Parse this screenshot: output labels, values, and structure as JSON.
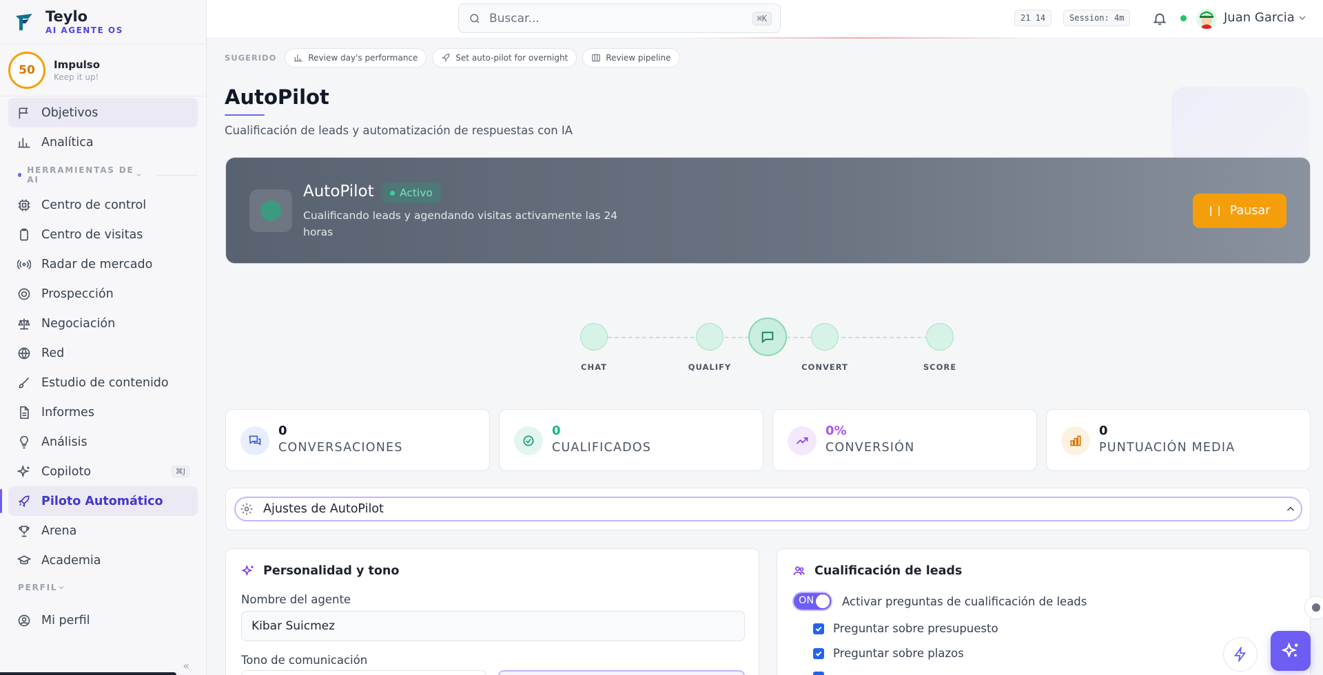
{
  "brand": {
    "name": "Teylo",
    "subtitle": "AI AGENTE OS"
  },
  "streak": {
    "value": "50",
    "title": "Impulso",
    "subtitle": "Keep it up!"
  },
  "nav": {
    "top_items": [
      {
        "label": "Objetivos",
        "icon": "flag-icon"
      },
      {
        "label": "Analítica",
        "icon": "bar-chart-icon"
      }
    ],
    "tools_section": "HERRAMIENTAS DE AI",
    "tools": [
      {
        "label": "Centro de control",
        "icon": "cpu-icon"
      },
      {
        "label": "Centro de visitas",
        "icon": "clipboard-icon"
      },
      {
        "label": "Radar de mercado",
        "icon": "radar-icon"
      },
      {
        "label": "Prospección",
        "icon": "target-icon"
      },
      {
        "label": "Negociación",
        "icon": "scale-icon"
      },
      {
        "label": "Red",
        "icon": "globe-icon"
      },
      {
        "label": "Estudio de contenido",
        "icon": "brush-icon"
      },
      {
        "label": "Informes",
        "icon": "file-icon"
      },
      {
        "label": "Análisis",
        "icon": "bulb-icon"
      },
      {
        "label": "Copiloto",
        "icon": "sparkle-icon",
        "shortcut": "⌘J"
      },
      {
        "label": "Piloto Automático",
        "icon": "rocket-icon"
      },
      {
        "label": "Arena",
        "icon": "trophy-icon"
      },
      {
        "label": "Academia",
        "icon": "graduation-icon"
      }
    ],
    "profile_section": "PERFIL",
    "profile_items": [
      {
        "label": "Mi perfil",
        "icon": "user-circle-icon"
      }
    ],
    "collapse_glyph": "«"
  },
  "topbar": {
    "search_placeholder": "Buscar...",
    "search_shortcut": "⌘K",
    "clock": "21 14",
    "session": "Session: 4m",
    "user_name": "Juan Garcia"
  },
  "suggested": {
    "label": "SUGERIDO",
    "chips": [
      "Review day's performance",
      "Set auto-pilot for overnight",
      "Review pipeline"
    ]
  },
  "page": {
    "title": "AutoPilot",
    "subtitle": "Cualificación de leads y automatización de respuestas con IA"
  },
  "hero": {
    "title": "AutoPilot",
    "status": "Activo",
    "description": "Cualificando leads y agendando visitas activamente las 24 horas",
    "pause_label": "Pausar"
  },
  "pipeline": {
    "stages": [
      "CHAT",
      "QUALIFY",
      "CONVERT",
      "SCORE"
    ]
  },
  "stats": [
    {
      "value": "0",
      "label": "CONVERSACIONES",
      "color": "#111827"
    },
    {
      "value": "0",
      "label": "CUALIFICADOS",
      "color": "#10b981"
    },
    {
      "value": "0%",
      "label": "CONVERSIÓN",
      "color": "#a855f7"
    },
    {
      "value": "0",
      "label": "PUNTUACIÓN MEDIA",
      "color": "#111827"
    }
  ],
  "settings": {
    "title": "Ajustes de AutoPilot"
  },
  "personality": {
    "title": "Personalidad y tono",
    "agent_name_label": "Nombre del agente",
    "agent_name_value": "Kibar Suicmez",
    "tone_label": "Tono de comunicación"
  },
  "qualification": {
    "title": "Cualificación de leads",
    "toggle_label": "ON",
    "toggle_text": "Activar preguntas de cualificación de leads",
    "checks": [
      "Preguntar sobre presupuesto",
      "Preguntar sobre plazos"
    ]
  },
  "colors": {
    "accent": "#6d5df3",
    "success": "#10b981",
    "warning": "#f59e0b"
  }
}
